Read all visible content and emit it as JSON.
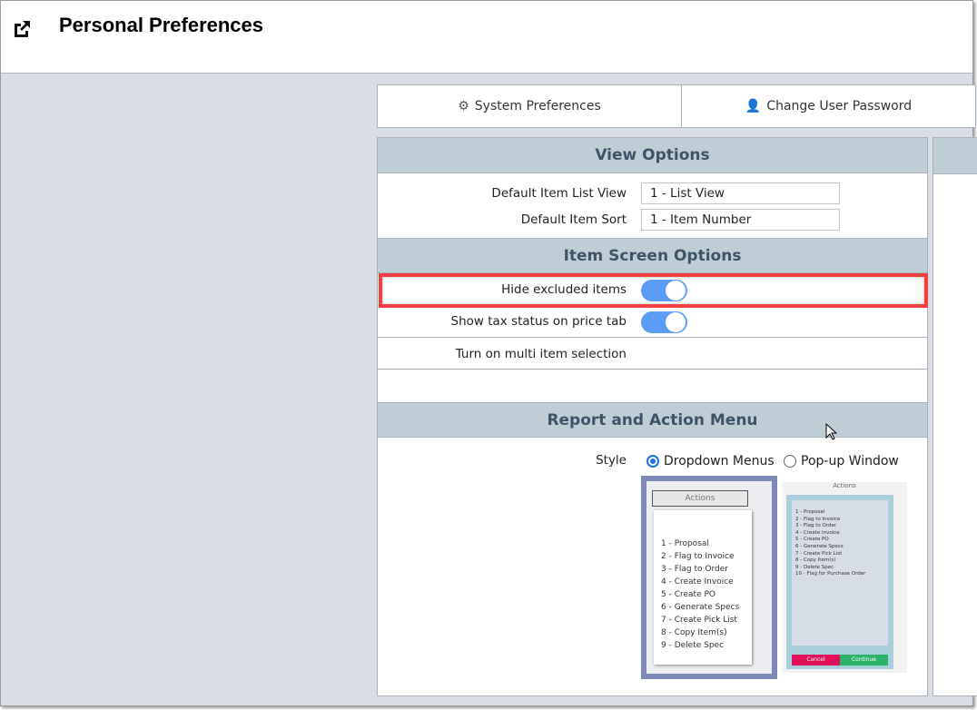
{
  "header": {
    "title": "Personal Preferences",
    "icon": "external-link-icon"
  },
  "tabs": [
    {
      "label": "System Preferences",
      "icon": "gear-icon"
    },
    {
      "label": "Change User Password",
      "icon": "user-edit-icon"
    }
  ],
  "view_options": {
    "title": "View Options",
    "list_view_label": "Default Item List View",
    "list_view_value": "1 - List View",
    "sort_label": "Default Item Sort",
    "sort_value": "1 - Item Number"
  },
  "item_screen": {
    "title": "Item Screen Options",
    "hide_excluded_label": "Hide excluded items",
    "hide_excluded_on": true,
    "tax_status_label": "Show tax status on price tab",
    "tax_status_on": true,
    "multi_select_label": "Turn on multi item selection"
  },
  "report_menu": {
    "title": "Report and Action Menu",
    "style_label": "Style",
    "options": [
      {
        "label": "Dropdown Menus",
        "selected": true
      },
      {
        "label": "Pop-up Window",
        "selected": false
      }
    ],
    "preview_dropdown": {
      "button": "Actions",
      "items": [
        "1 - Proposal",
        "2 - Flag to Invoice",
        "3 - Flag to Order",
        "4 - Create Invoice",
        "5 - Create PO",
        "6 - Generate Specs",
        "7 - Create Pick List",
        "8 - Copy Item(s)",
        "9 - Delete Spec"
      ]
    },
    "preview_popup": {
      "button": "Actions",
      "items": [
        "1 - Proposal",
        "2 - Flag to Invoice",
        "3 - Flag to Order",
        "4 - Create Invoice",
        "5 - Create PO",
        "6 - Generate Specs",
        "7 - Create Pick List",
        "8 - Copy Item(s)",
        "9 - Delete Spec",
        "10 - Flag for Purchase Order"
      ],
      "cancel": "Cancel",
      "continue": "Continue"
    }
  },
  "colors": {
    "section_header": "#bfced6",
    "toggle_on": "#5a9cf6",
    "highlight": "#f04040"
  }
}
